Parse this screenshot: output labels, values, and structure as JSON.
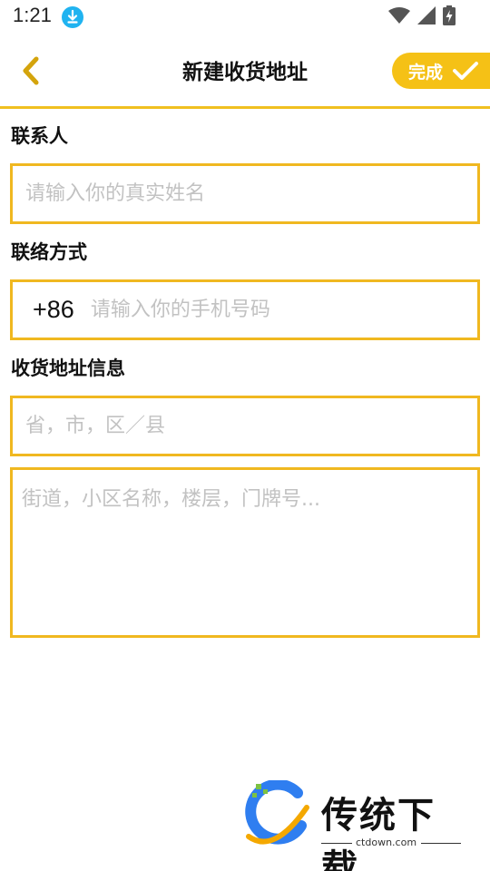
{
  "status_bar": {
    "time": "1:21"
  },
  "header": {
    "title": "新建收货地址",
    "done_label": "完成"
  },
  "colors": {
    "accent": "#f5c116",
    "border": "#f0b820",
    "download_badge": "#20b3f0"
  },
  "form": {
    "contact": {
      "label": "联系人",
      "placeholder": "请输入你的真实姓名"
    },
    "phone": {
      "label": "联络方式",
      "country_code": "+86",
      "placeholder": "请输入你的手机号码"
    },
    "address": {
      "label": "收货地址信息",
      "region_placeholder": "省，市，区／县",
      "detail_placeholder": "街道，小区名称，楼层，门牌号..."
    }
  },
  "watermark": {
    "brand": "传统下载",
    "url": "ctdown.com"
  }
}
